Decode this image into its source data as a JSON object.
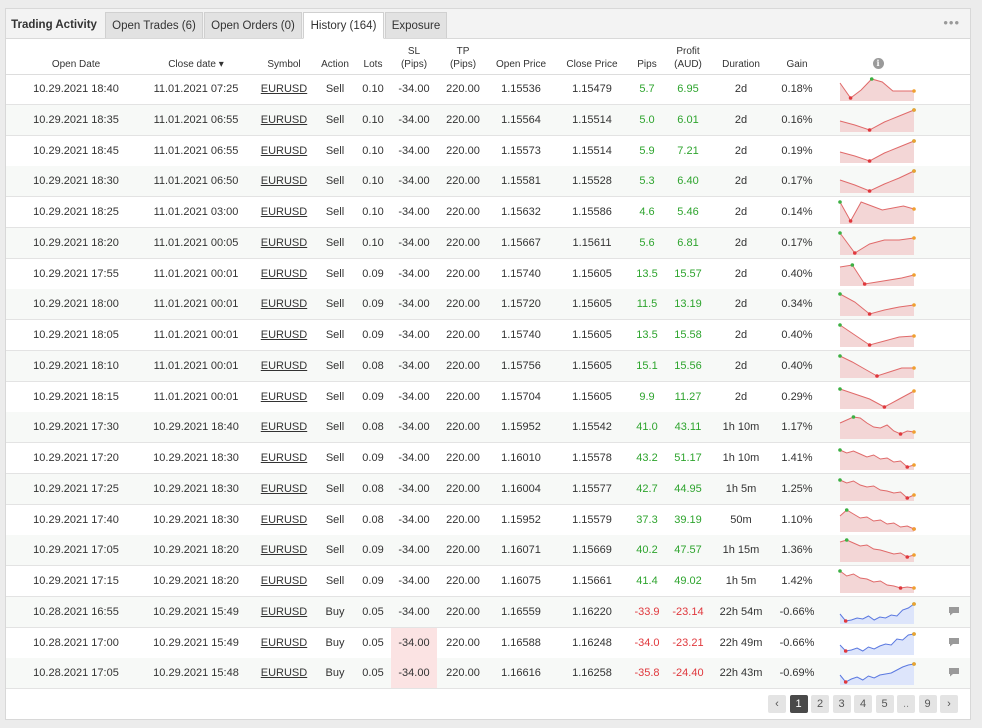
{
  "tabs": {
    "title": "Trading Activity",
    "open_trades": "Open Trades (6)",
    "open_orders": "Open Orders (0)",
    "history": "History (164)",
    "exposure": "Exposure",
    "more": "•••"
  },
  "columns": {
    "open_date": "Open Date",
    "close_date": "Close date ▾",
    "symbol": "Symbol",
    "action": "Action",
    "lots": "Lots",
    "sl1": "SL",
    "sl2": "(Pips)",
    "tp1": "TP",
    "tp2": "(Pips)",
    "open_price": "Open Price",
    "close_price": "Close Price",
    "pips": "Pips",
    "profit1": "Profit",
    "profit2": "(AUD)",
    "duration": "Duration",
    "gain": "Gain",
    "info": "i"
  },
  "colors": {
    "profit": "#2ea42e",
    "loss": "#e0383d",
    "sell_spark_line": "#e06a6a",
    "sell_spark_fill": "#f3d6d6",
    "buy_spark_line": "#5a78e0",
    "buy_spark_fill": "#dde5fb"
  },
  "rows": [
    {
      "open": "10.29.2021 18:40",
      "close": "11.01.2021 07:25",
      "symbol": "EURUSD",
      "action": "Sell",
      "lots": "0.10",
      "sl": "-34.00",
      "tp": "220.00",
      "open_price": "1.15536",
      "close_price": "1.15479",
      "pips": "5.7",
      "profit": "6.95",
      "duration": "2d",
      "gain": "0.18%",
      "sign": "pos",
      "spark": [
        0.2,
        0.95,
        0.55,
        0.0,
        0.15,
        0.6,
        0.6,
        0.6
      ],
      "comment": false,
      "sl_highlight": false
    },
    {
      "open": "10.29.2021 18:35",
      "close": "11.01.2021 06:55",
      "symbol": "EURUSD",
      "action": "Sell",
      "lots": "0.10",
      "sl": "-34.00",
      "tp": "220.00",
      "open_price": "1.15564",
      "close_price": "1.15514",
      "pips": "5.0",
      "profit": "6.01",
      "duration": "2d",
      "gain": "0.16%",
      "sign": "pos",
      "spark": [
        0.55,
        0.75,
        1.0,
        0.6,
        0.3,
        0.0
      ],
      "comment": false,
      "sl_highlight": false
    },
    {
      "open": "10.29.2021 18:45",
      "close": "11.01.2021 06:55",
      "symbol": "EURUSD",
      "action": "Sell",
      "lots": "0.10",
      "sl": "-34.00",
      "tp": "220.00",
      "open_price": "1.15573",
      "close_price": "1.15514",
      "pips": "5.9",
      "profit": "7.21",
      "duration": "2d",
      "gain": "0.19%",
      "sign": "pos",
      "spark": [
        0.55,
        0.75,
        1.0,
        0.6,
        0.3,
        0.0
      ],
      "comment": false,
      "sl_highlight": false
    },
    {
      "open": "10.29.2021 18:30",
      "close": "11.01.2021 06:50",
      "symbol": "EURUSD",
      "action": "Sell",
      "lots": "0.10",
      "sl": "-34.00",
      "tp": "220.00",
      "open_price": "1.15581",
      "close_price": "1.15528",
      "pips": "5.3",
      "profit": "6.40",
      "duration": "2d",
      "gain": "0.17%",
      "sign": "pos",
      "spark": [
        0.45,
        0.7,
        1.0,
        0.65,
        0.35,
        0.0
      ],
      "comment": false,
      "sl_highlight": false
    },
    {
      "open": "10.29.2021 18:25",
      "close": "11.01.2021 03:00",
      "symbol": "EURUSD",
      "action": "Sell",
      "lots": "0.10",
      "sl": "-34.00",
      "tp": "220.00",
      "open_price": "1.15632",
      "close_price": "1.15586",
      "pips": "4.6",
      "profit": "5.46",
      "duration": "2d",
      "gain": "0.14%",
      "sign": "pos",
      "spark": [
        0.0,
        0.95,
        0.0,
        0.2,
        0.4,
        0.3,
        0.2,
        0.35
      ],
      "comment": false,
      "sl_highlight": false
    },
    {
      "open": "10.29.2021 18:20",
      "close": "11.01.2021 00:05",
      "symbol": "EURUSD",
      "action": "Sell",
      "lots": "0.10",
      "sl": "-34.00",
      "tp": "220.00",
      "open_price": "1.15667",
      "close_price": "1.15611",
      "pips": "5.6",
      "profit": "6.81",
      "duration": "2d",
      "gain": "0.17%",
      "sign": "pos",
      "spark": [
        0.0,
        1.0,
        0.55,
        0.35,
        0.35,
        0.25
      ],
      "comment": false,
      "sl_highlight": false
    },
    {
      "open": "10.29.2021 17:55",
      "close": "11.01.2021 00:01",
      "symbol": "EURUSD",
      "action": "Sell",
      "lots": "0.09",
      "sl": "-34.00",
      "tp": "220.00",
      "open_price": "1.15740",
      "close_price": "1.15605",
      "pips": "13.5",
      "profit": "15.57",
      "duration": "2d",
      "gain": "0.40%",
      "sign": "pos",
      "spark": [
        0.15,
        0.05,
        1.0,
        0.9,
        0.8,
        0.7,
        0.55
      ],
      "comment": false,
      "sl_highlight": false
    },
    {
      "open": "10.29.2021 18:00",
      "close": "11.01.2021 00:01",
      "symbol": "EURUSD",
      "action": "Sell",
      "lots": "0.09",
      "sl": "-34.00",
      "tp": "220.00",
      "open_price": "1.15720",
      "close_price": "1.15605",
      "pips": "11.5",
      "profit": "13.19",
      "duration": "2d",
      "gain": "0.34%",
      "sign": "pos",
      "spark": [
        0.0,
        0.4,
        1.0,
        0.8,
        0.65,
        0.55
      ],
      "comment": false,
      "sl_highlight": false
    },
    {
      "open": "10.29.2021 18:05",
      "close": "11.01.2021 00:01",
      "symbol": "EURUSD",
      "action": "Sell",
      "lots": "0.09",
      "sl": "-34.00",
      "tp": "220.00",
      "open_price": "1.15740",
      "close_price": "1.15605",
      "pips": "13.5",
      "profit": "15.58",
      "duration": "2d",
      "gain": "0.40%",
      "sign": "pos",
      "spark": [
        0.0,
        0.5,
        1.0,
        0.8,
        0.6,
        0.55
      ],
      "comment": false,
      "sl_highlight": false
    },
    {
      "open": "10.29.2021 18:10",
      "close": "11.01.2021 00:01",
      "symbol": "EURUSD",
      "action": "Sell",
      "lots": "0.08",
      "sl": "-34.00",
      "tp": "220.00",
      "open_price": "1.15756",
      "close_price": "1.15605",
      "pips": "15.1",
      "profit": "15.56",
      "duration": "2d",
      "gain": "0.40%",
      "sign": "pos",
      "spark": [
        0.0,
        0.3,
        0.65,
        1.0,
        0.8,
        0.6,
        0.6
      ],
      "comment": false,
      "sl_highlight": false
    },
    {
      "open": "10.29.2021 18:15",
      "close": "11.01.2021 00:01",
      "symbol": "EURUSD",
      "action": "Sell",
      "lots": "0.09",
      "sl": "-34.00",
      "tp": "220.00",
      "open_price": "1.15704",
      "close_price": "1.15605",
      "pips": "9.9",
      "profit": "11.27",
      "duration": "2d",
      "gain": "0.29%",
      "sign": "pos",
      "spark": [
        0.1,
        0.35,
        0.6,
        1.0,
        0.6,
        0.2
      ],
      "comment": false,
      "sl_highlight": false
    },
    {
      "open": "10.29.2021 17:30",
      "close": "10.29.2021 18:40",
      "symbol": "EURUSD",
      "action": "Sell",
      "lots": "0.08",
      "sl": "-34.00",
      "tp": "220.00",
      "open_price": "1.15952",
      "close_price": "1.15542",
      "pips": "41.0",
      "profit": "43.11",
      "duration": "1h 10m",
      "gain": "1.17%",
      "sign": "pos",
      "spark": [
        0.3,
        0.15,
        0.0,
        0.05,
        0.3,
        0.5,
        0.55,
        0.4,
        0.7,
        0.85,
        0.7,
        0.75
      ],
      "comment": false,
      "sl_highlight": false
    },
    {
      "open": "10.29.2021 17:20",
      "close": "10.29.2021 18:30",
      "symbol": "EURUSD",
      "action": "Sell",
      "lots": "0.09",
      "sl": "-34.00",
      "tp": "220.00",
      "open_price": "1.16010",
      "close_price": "1.15578",
      "pips": "43.2",
      "profit": "51.17",
      "duration": "1h 10m",
      "gain": "1.41%",
      "sign": "pos",
      "spark": [
        0.1,
        0.25,
        0.15,
        0.3,
        0.45,
        0.35,
        0.55,
        0.5,
        0.7,
        0.65,
        0.95,
        0.85
      ],
      "comment": false,
      "sl_highlight": false
    },
    {
      "open": "10.29.2021 17:25",
      "close": "10.29.2021 18:30",
      "symbol": "EURUSD",
      "action": "Sell",
      "lots": "0.08",
      "sl": "-34.00",
      "tp": "220.00",
      "open_price": "1.16004",
      "close_price": "1.15577",
      "pips": "42.7",
      "profit": "44.95",
      "duration": "1h 5m",
      "gain": "1.25%",
      "sign": "pos",
      "spark": [
        0.05,
        0.2,
        0.1,
        0.3,
        0.4,
        0.35,
        0.55,
        0.6,
        0.7,
        0.65,
        0.95,
        0.8
      ],
      "comment": false,
      "sl_highlight": false
    },
    {
      "open": "10.29.2021 17:40",
      "close": "10.29.2021 18:30",
      "symbol": "EURUSD",
      "action": "Sell",
      "lots": "0.08",
      "sl": "-34.00",
      "tp": "220.00",
      "open_price": "1.15952",
      "close_price": "1.15579",
      "pips": "37.3",
      "profit": "39.19",
      "duration": "50m",
      "gain": "1.10%",
      "sign": "pos",
      "spark": [
        0.3,
        0.0,
        0.2,
        0.4,
        0.35,
        0.55,
        0.5,
        0.7,
        0.65,
        0.85,
        0.8,
        0.95
      ],
      "comment": false,
      "sl_highlight": false
    },
    {
      "open": "10.29.2021 17:05",
      "close": "10.29.2021 18:20",
      "symbol": "EURUSD",
      "action": "Sell",
      "lots": "0.09",
      "sl": "-34.00",
      "tp": "220.00",
      "open_price": "1.16071",
      "close_price": "1.15669",
      "pips": "40.2",
      "profit": "47.57",
      "duration": "1h 15m",
      "gain": "1.36%",
      "sign": "pos",
      "spark": [
        0.1,
        0.0,
        0.15,
        0.3,
        0.25,
        0.45,
        0.5,
        0.6,
        0.7,
        0.65,
        0.85,
        0.75
      ],
      "comment": false,
      "sl_highlight": false
    },
    {
      "open": "10.29.2021 17:15",
      "close": "10.29.2021 18:20",
      "symbol": "EURUSD",
      "action": "Sell",
      "lots": "0.09",
      "sl": "-34.00",
      "tp": "220.00",
      "open_price": "1.16075",
      "close_price": "1.15661",
      "pips": "41.4",
      "profit": "49.02",
      "duration": "1h 5m",
      "gain": "1.42%",
      "sign": "pos",
      "spark": [
        0.0,
        0.25,
        0.15,
        0.35,
        0.4,
        0.55,
        0.5,
        0.7,
        0.75,
        0.85,
        0.8,
        0.85
      ],
      "comment": false,
      "sl_highlight": false
    },
    {
      "open": "10.28.2021 16:55",
      "close": "10.29.2021 15:49",
      "symbol": "EURUSD",
      "action": "Buy",
      "lots": "0.05",
      "sl": "-34.00",
      "tp": "220.00",
      "open_price": "1.16559",
      "close_price": "1.16220",
      "pips": "-33.9",
      "profit": "-23.14",
      "duration": "22h 54m",
      "gain": "-0.66%",
      "sign": "neg",
      "spark": [
        0.6,
        0.95,
        0.9,
        0.8,
        0.85,
        0.7,
        0.9,
        0.75,
        0.8,
        0.65,
        0.7,
        0.4,
        0.3,
        0.1
      ],
      "comment": true,
      "sl_highlight": false
    },
    {
      "open": "10.28.2021 17:00",
      "close": "10.29.2021 15:49",
      "symbol": "EURUSD",
      "action": "Buy",
      "lots": "0.05",
      "sl": "-34.00",
      "tp": "220.00",
      "open_price": "1.16588",
      "close_price": "1.16248",
      "pips": "-34.0",
      "profit": "-23.21",
      "duration": "22h 49m",
      "gain": "-0.66%",
      "sign": "neg",
      "spark": [
        0.6,
        0.9,
        0.85,
        0.75,
        0.9,
        0.7,
        0.8,
        0.65,
        0.55,
        0.6,
        0.3,
        0.35,
        0.1,
        0.05
      ],
      "comment": true,
      "sl_highlight": true
    },
    {
      "open": "10.28.2021 17:05",
      "close": "10.29.2021 15:48",
      "symbol": "EURUSD",
      "action": "Buy",
      "lots": "0.05",
      "sl": "-34.00",
      "tp": "220.00",
      "open_price": "1.16616",
      "close_price": "1.16258",
      "pips": "-35.8",
      "profit": "-24.40",
      "duration": "22h 43m",
      "gain": "-0.69%",
      "sign": "neg",
      "spark": [
        0.6,
        0.95,
        0.8,
        0.7,
        0.85,
        0.65,
        0.75,
        0.6,
        0.55,
        0.5,
        0.35,
        0.2,
        0.1,
        0.05
      ],
      "comment": true,
      "sl_highlight": true
    }
  ],
  "pagination": {
    "prev": "‹",
    "pages": [
      "1",
      "2",
      "3",
      "4",
      "5",
      "..",
      "9"
    ],
    "active": "1",
    "next": "›"
  }
}
